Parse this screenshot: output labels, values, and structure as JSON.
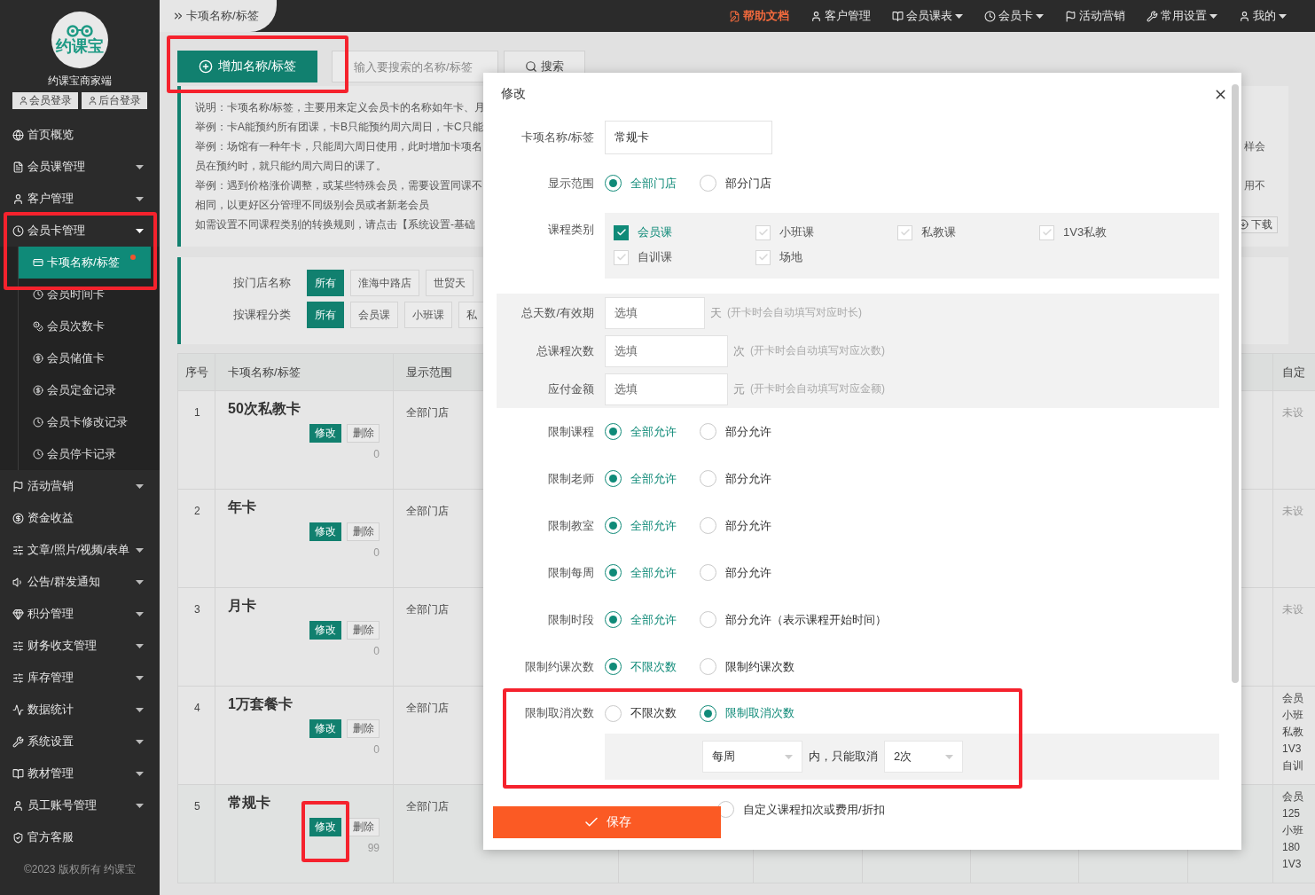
{
  "sidebar": {
    "logo_text": "约课宝",
    "title": "约课宝商家端",
    "login_buttons": [
      "会员登录",
      "后台登录"
    ],
    "menu": [
      {
        "label": "首页概览",
        "kind": "link"
      },
      {
        "label": "会员课管理",
        "kind": "group",
        "expanded": false
      },
      {
        "label": "客户管理",
        "kind": "group",
        "expanded": false
      },
      {
        "label": "会员卡管理",
        "kind": "group",
        "expanded": true,
        "highlighted": true,
        "children": [
          {
            "label": "卡项名称/标签",
            "selected": true,
            "notice": true
          },
          {
            "label": "会员时间卡",
            "selected": false,
            "notice": false
          },
          {
            "label": "会员次数卡",
            "selected": false,
            "notice": false
          },
          {
            "label": "会员储值卡",
            "selected": false,
            "notice": false
          },
          {
            "label": "会员定金记录",
            "selected": false,
            "notice": false
          },
          {
            "label": "会员卡修改记录",
            "selected": false,
            "notice": false
          },
          {
            "label": "会员停卡记录",
            "selected": false,
            "notice": false
          }
        ]
      },
      {
        "label": "活动营销",
        "kind": "group",
        "expanded": false
      },
      {
        "label": "资金收益",
        "kind": "link"
      },
      {
        "label": "文章/照片/视频/表单",
        "kind": "group",
        "expanded": false
      },
      {
        "label": "公告/群发通知",
        "kind": "group",
        "expanded": false
      },
      {
        "label": "积分管理",
        "kind": "group",
        "expanded": false
      },
      {
        "label": "财务收支管理",
        "kind": "group",
        "expanded": false
      },
      {
        "label": "库存管理",
        "kind": "group",
        "expanded": false
      },
      {
        "label": "数据统计",
        "kind": "group",
        "expanded": false
      },
      {
        "label": "系统设置",
        "kind": "group",
        "expanded": false
      },
      {
        "label": "教材管理",
        "kind": "group",
        "expanded": false
      },
      {
        "label": "员工账号管理",
        "kind": "group",
        "expanded": false
      },
      {
        "label": "官方客服",
        "kind": "link"
      }
    ],
    "footer": "©2023 版权所有 约课宝"
  },
  "topbar": {
    "breadcrumb": "卡项名称/标签",
    "nav": [
      {
        "label": "帮助文档",
        "kind": "help",
        "dropdown": false
      },
      {
        "label": "客户管理",
        "kind": "link",
        "dropdown": false
      },
      {
        "label": "会员课表",
        "kind": "link",
        "dropdown": true
      },
      {
        "label": "会员卡",
        "kind": "link",
        "dropdown": true
      },
      {
        "label": "活动营销",
        "kind": "link",
        "dropdown": false
      },
      {
        "label": "常用设置",
        "kind": "link",
        "dropdown": true
      },
      {
        "label": "我的",
        "kind": "link",
        "dropdown": true
      }
    ]
  },
  "toolbar": {
    "add_button": {
      "label": "增加名称/标签",
      "highlighted": true
    },
    "search": {
      "placeholder": "输入要搜索的名称/标签"
    },
    "search_button": "搜索"
  },
  "notes": [
    {
      "text": "说明：卡项名称/标签，主要用来定义会员卡的名称如年卡、月"
    },
    {
      "text": "举例：卡A能预约所有团课，卡B只能预约周六周日，卡C只能"
    },
    {
      "text": "举例：场馆有一种年卡，只能周六周日使用，此时增加卡项名",
      "tail": "样会"
    },
    {
      "text": "员在预约时，就只能约周六周日的课了。"
    },
    {
      "text": "举例：遇到价格涨价调整，或某些特殊会员，需要设置同课不",
      "tail": "用不"
    },
    {
      "text": "相同，以更好区分管理不同级别会员或者新老会员"
    },
    {
      "text": "如需设置不同课程类别的转换规则，请点击【系统设置-基础"
    }
  ],
  "download_button": "下载",
  "filters": [
    {
      "label": "按门店名称",
      "options": [
        {
          "label": "所有",
          "selected": true
        },
        {
          "label": "淮海中路店",
          "selected": false
        },
        {
          "label": "世贸天",
          "selected": false
        }
      ]
    },
    {
      "label": "按课程分类",
      "options": [
        {
          "label": "所有",
          "selected": true
        },
        {
          "label": "会员课",
          "selected": false
        },
        {
          "label": "小班课",
          "selected": false
        },
        {
          "label": "私",
          "selected": false
        }
      ]
    }
  ],
  "table": {
    "columns": [
      "序号",
      "卡项名称/标签",
      "显示范围",
      "自定"
    ],
    "rows": [
      {
        "index": "1",
        "name": "50次私教卡",
        "edit": "修改",
        "delete": "删除",
        "count": "0",
        "scope": "全部门店",
        "custom": [
          "未设"
        ],
        "annotated": false
      },
      {
        "index": "2",
        "name": "年卡",
        "edit": "修改",
        "delete": "删除",
        "count": "0",
        "scope": "全部门店",
        "custom": [
          "未设"
        ],
        "annotated": false
      },
      {
        "index": "3",
        "name": "月卡",
        "edit": "修改",
        "delete": "删除",
        "count": "0",
        "scope": "全部门店",
        "custom": [
          "未设"
        ],
        "annotated": false
      },
      {
        "index": "4",
        "name": "1万套餐卡",
        "edit": "修改",
        "delete": "删除",
        "count": "0",
        "scope": "全部门店",
        "custom": [
          "会员",
          "小班",
          "私教",
          "1V3",
          "自训"
        ],
        "annotated": false
      },
      {
        "index": "5",
        "name": "常规卡",
        "edit": "修改",
        "delete": "删除",
        "count": "99",
        "scope": "全部门店",
        "custom": [
          "会员",
          "125",
          "小班",
          "180",
          "1V3"
        ],
        "annotated": true
      }
    ]
  },
  "dialog": {
    "title": "修改",
    "fields": [
      {
        "kind": "text",
        "label": "卡项名称/标签",
        "value": "常规卡"
      },
      {
        "kind": "radio",
        "label": "显示范围",
        "options": [
          {
            "label": "全部门店",
            "selected": true
          },
          {
            "label": "部分门店",
            "selected": false
          }
        ]
      },
      {
        "kind": "checkboxes",
        "label": "课程类别",
        "options": [
          {
            "label": "会员课",
            "checked": true
          },
          {
            "label": "小班课",
            "checked": false
          },
          {
            "label": "私教课",
            "checked": false
          },
          {
            "label": "1V3私教",
            "checked": false
          },
          {
            "label": "自训课",
            "checked": false
          },
          {
            "label": "场地",
            "checked": false
          }
        ]
      },
      {
        "kind": "number",
        "label": "总天数/有效期",
        "placeholder": "选填",
        "unit": "天",
        "hint": "(开卡时会自动填写对应时长)"
      },
      {
        "kind": "number",
        "label": "总课程次数",
        "placeholder": "选填",
        "unit": "次",
        "hint": "(开卡时会自动填写对应次数)"
      },
      {
        "kind": "number",
        "label": "应付金额",
        "placeholder": "选填",
        "unit": "元",
        "hint": "(开卡时会自动填写对应金额)"
      },
      {
        "kind": "radio",
        "label": "限制课程",
        "options": [
          {
            "label": "全部允许",
            "selected": true
          },
          {
            "label": "部分允许",
            "selected": false
          }
        ]
      },
      {
        "kind": "radio",
        "label": "限制老师",
        "options": [
          {
            "label": "全部允许",
            "selected": true
          },
          {
            "label": "部分允许",
            "selected": false
          }
        ]
      },
      {
        "kind": "radio",
        "label": "限制教室",
        "options": [
          {
            "label": "全部允许",
            "selected": true
          },
          {
            "label": "部分允许",
            "selected": false
          }
        ]
      },
      {
        "kind": "radio",
        "label": "限制每周",
        "options": [
          {
            "label": "全部允许",
            "selected": true
          },
          {
            "label": "部分允许",
            "selected": false
          }
        ]
      },
      {
        "kind": "radio",
        "label": "限制时段",
        "options": [
          {
            "label": "全部允许",
            "selected": true
          },
          {
            "label": "部分允许（表示课程开始时间）",
            "selected": false
          }
        ]
      },
      {
        "kind": "radio",
        "label": "限制约课次数",
        "options": [
          {
            "label": "不限次数",
            "selected": true
          },
          {
            "label": "限制约课次数",
            "selected": false
          }
        ]
      },
      {
        "kind": "limit",
        "label": "限制取消次数",
        "annotated": true,
        "options": [
          {
            "label": "不限次数",
            "selected": false
          },
          {
            "label": "限制取消次数",
            "selected": true
          }
        ],
        "period": "每周",
        "middle": "内，只能取消",
        "count": "2次"
      },
      {
        "kind": "partial",
        "options": [
          {
            "label": "自定义课程扣次或费用/折扣",
            "selected": false
          }
        ]
      }
    ],
    "save_button": "保存"
  }
}
